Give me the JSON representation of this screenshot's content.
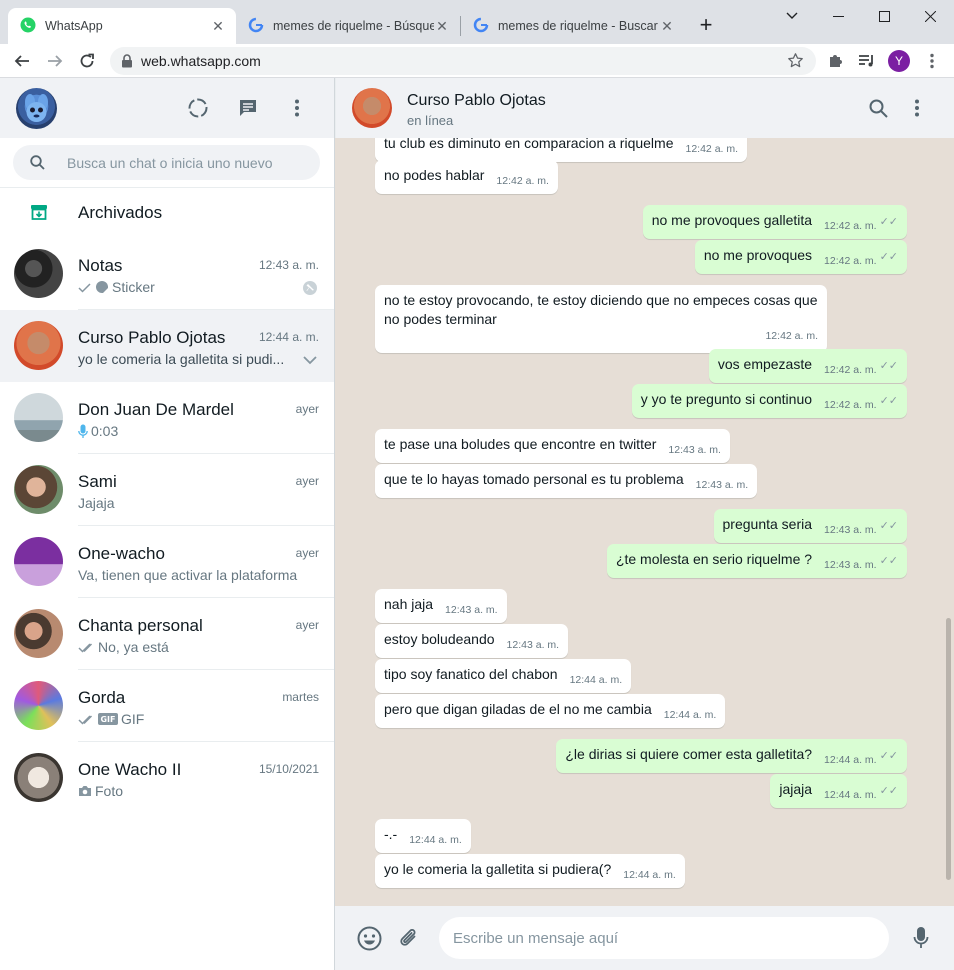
{
  "browser": {
    "tabs": [
      {
        "title": "WhatsApp",
        "active": true
      },
      {
        "title": "memes de riquelme - Búsqueda",
        "active": false
      },
      {
        "title": "memes de riquelme - Buscar c",
        "active": false
      }
    ],
    "url": "web.whatsapp.com",
    "profile_initial": "Y"
  },
  "search": {
    "placeholder": "Busca un chat o inicia uno nuevo"
  },
  "archived_label": "Archivados",
  "chats": [
    {
      "name": "Notas",
      "time": "12:43 a. m.",
      "preview": "Sticker"
    },
    {
      "name": "Curso Pablo Ojotas",
      "time": "12:44 a. m.",
      "preview": "yo le comeria la galletita si pudi..."
    },
    {
      "name": "Don Juan De Mardel",
      "time": "ayer",
      "preview": "0:03"
    },
    {
      "name": "Sami",
      "time": "ayer",
      "preview": "Jajaja"
    },
    {
      "name": "One-wacho",
      "time": "ayer",
      "preview": "Va, tienen que activar la plataforma"
    },
    {
      "name": "Chanta personal",
      "time": "ayer",
      "preview": "No, ya está"
    },
    {
      "name": "Gorda",
      "time": "martes",
      "preview": "GIF"
    },
    {
      "name": "One Wacho II",
      "time": "15/10/2021",
      "preview": "Foto"
    }
  ],
  "conversation": {
    "title": "Curso Pablo Ojotas",
    "status": "en línea",
    "messages": [
      {
        "dir": "in",
        "text": "tu club es diminuto en comparacion a riquelme",
        "time": "12:42 a. m."
      },
      {
        "dir": "in",
        "text": "no podes hablar",
        "time": "12:42 a. m."
      },
      {
        "dir": "out",
        "text": "no me provoques galletita",
        "time": "12:42 a. m."
      },
      {
        "dir": "out",
        "text": "no me provoques",
        "time": "12:42 a. m."
      },
      {
        "dir": "in",
        "text": "no te estoy provocando, te estoy diciendo que no empeces cosas que no podes terminar",
        "time": "12:42 a. m."
      },
      {
        "dir": "out",
        "text": "vos empezaste",
        "time": "12:42 a. m."
      },
      {
        "dir": "out",
        "text": "y yo te pregunto si continuo",
        "time": "12:42 a. m."
      },
      {
        "dir": "in",
        "text": "te pase una boludes que encontre en twitter",
        "time": "12:43 a. m."
      },
      {
        "dir": "in",
        "text": "que te lo hayas tomado personal es tu problema",
        "time": "12:43 a. m."
      },
      {
        "dir": "out",
        "text": "pregunta seria",
        "time": "12:43 a. m."
      },
      {
        "dir": "out",
        "text": "¿te molesta en serio riquelme ?",
        "time": "12:43 a. m."
      },
      {
        "dir": "in",
        "text": "nah jaja",
        "time": "12:43 a. m."
      },
      {
        "dir": "in",
        "text": "estoy boludeando",
        "time": "12:43 a. m."
      },
      {
        "dir": "in",
        "text": "tipo soy fanatico del chabon",
        "time": "12:44 a. m."
      },
      {
        "dir": "in",
        "text": "pero que digan giladas de el no me cambia",
        "time": "12:44 a. m."
      },
      {
        "dir": "out",
        "text": "¿le dirias si quiere comer esta galletita?",
        "time": "12:44 a. m."
      },
      {
        "dir": "out",
        "text": "jajaja",
        "time": "12:44 a. m."
      },
      {
        "dir": "in",
        "text": "-.-",
        "time": "12:44 a. m."
      },
      {
        "dir": "in",
        "text": "yo le comeria la galletita si pudiera(?",
        "time": "12:44 a. m."
      }
    ]
  },
  "composer": {
    "placeholder": "Escribe un mensaje aquí"
  },
  "colors": {
    "accent": "#25d366",
    "outgoing_bubble": "#d9fdd3",
    "chat_bg": "#e6ded6"
  }
}
